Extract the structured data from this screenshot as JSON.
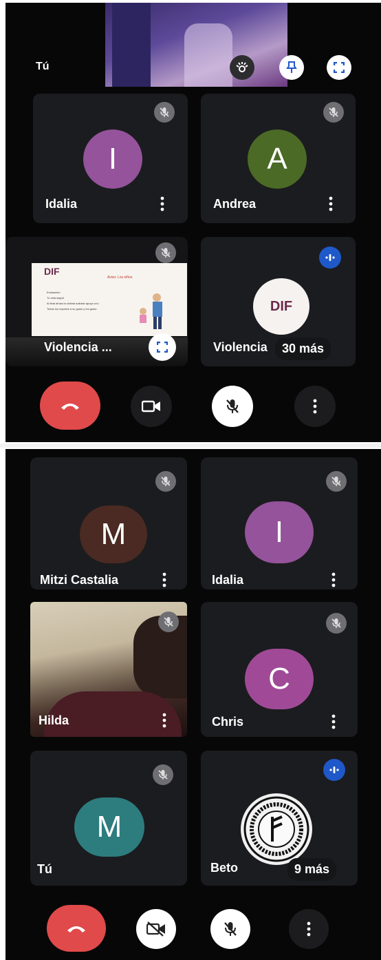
{
  "screen1": {
    "self_view": {
      "label": "Tú"
    },
    "tiles": [
      {
        "name": "Idalia",
        "initial": "I",
        "color": "#94539a"
      },
      {
        "name": "Andrea",
        "initial": "A",
        "color": "#4b6a26"
      },
      {
        "name": "Violencia ..."
      },
      {
        "name": "Violencia",
        "more": "30 más"
      }
    ],
    "presentation": {
      "logo": "DIF",
      "title": "Aviso: Los niños",
      "bullets": [
        "Evaluación",
        "Tu vida seguir",
        "Al final ahora la victima solicitar apoyo a tu",
        "Todos los reportes a su gusto y los gusto"
      ]
    },
    "dif_logo": "DIF"
  },
  "screen2": {
    "tiles": [
      {
        "name": "Mitzi Castalia",
        "initial": "M",
        "color": "#4a2a22"
      },
      {
        "name": "Idalia",
        "initial": "I",
        "color": "#94539a"
      },
      {
        "name": "Hilda"
      },
      {
        "name": "Chris",
        "initial": "C",
        "color": "#a04a97"
      },
      {
        "name": "Tú",
        "initial": "M",
        "color": "#2d7c7e"
      },
      {
        "name": "Beto",
        "more": "9 más"
      }
    ]
  },
  "colors": {
    "hangup": "#e04a4a",
    "speaking": "#1f58c8",
    "muted_badge": "#6f6f73"
  }
}
